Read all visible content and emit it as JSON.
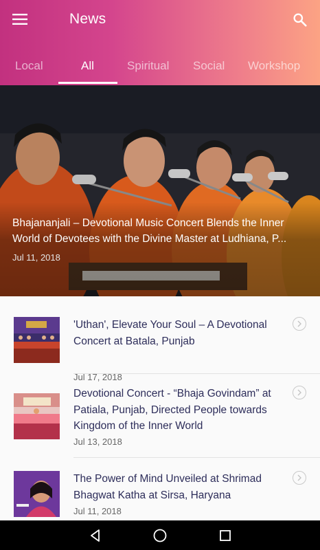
{
  "app": {
    "title": "News",
    "menu_icon": "hamburger-menu-icon",
    "search_icon": "search-icon",
    "gradient_start": "#c2317f",
    "gradient_end": "#fca384"
  },
  "tabs": [
    {
      "label": "Local",
      "active": false
    },
    {
      "label": "All",
      "active": true
    },
    {
      "label": "Spiritual",
      "active": false
    },
    {
      "label": "Social",
      "active": false
    },
    {
      "label": "Workshop",
      "active": false
    }
  ],
  "hero": {
    "title": "Bhajananjali – Devotional Music Concert Blends the Inner World of Devotees with the Divine Master at Ludhiana, P...",
    "date": "Jul 11, 2018"
  },
  "articles": [
    {
      "title": "'Uthan', Elevate Your Soul – A Devotional Concert at Batala, Punjab",
      "date": "Jul 17, 2018",
      "chevron_icon": "chevron-right-circle-icon"
    },
    {
      "title": "Devotional Concert - “Bhaja Govindam” at Patiala, Punjab, Directed People towards Kingdom of the Inner World",
      "date": "Jul 13, 2018",
      "chevron_icon": "chevron-right-circle-icon"
    },
    {
      "title": "The Power of Mind Unveiled at Shrimad Bhagwat Katha at Sirsa, Haryana",
      "date": "Jul 11, 2018",
      "chevron_icon": "chevron-right-circle-icon"
    }
  ],
  "system_nav": {
    "back_icon": "back-triangle-icon",
    "home_icon": "home-circle-icon",
    "recents_icon": "recents-square-icon"
  }
}
